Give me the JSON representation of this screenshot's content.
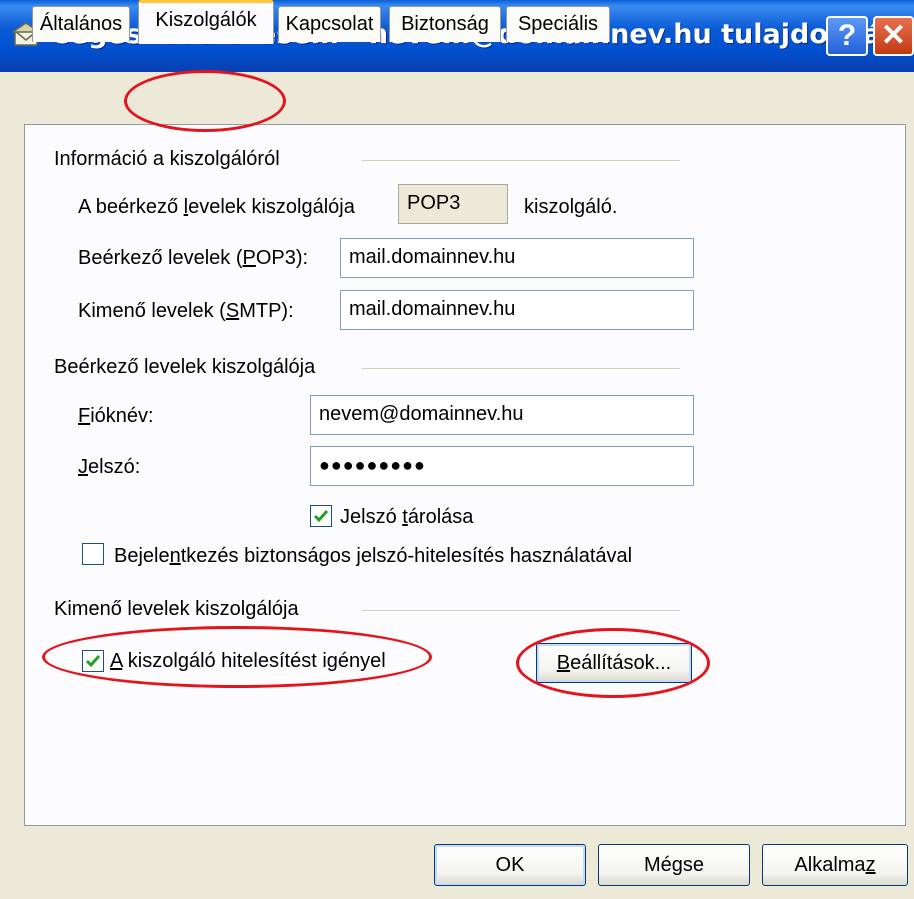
{
  "window": {
    "title": "Céges levelezésem - nevem@domainnev.hu tulajdonságai",
    "help_glyph": "?",
    "close_glyph": "✕"
  },
  "tabs": [
    {
      "label": "Általános"
    },
    {
      "label": "Kiszolgálók"
    },
    {
      "label": "Kapcsolat"
    },
    {
      "label": "Biztonság"
    },
    {
      "label": "Speciális"
    }
  ],
  "server_info": {
    "group_title": "Információ a kiszolgálóról",
    "incoming_type_label_pre": "A beérkező ",
    "incoming_type_label_ul": "l",
    "incoming_type_label_post": "evelek kiszolgálója",
    "incoming_type_value": "POP3",
    "incoming_type_suffix": "kiszolgáló.",
    "pop3_label_pre": "Beérkező levelek (",
    "pop3_label_ul": "P",
    "pop3_label_post": "OP3):",
    "pop3_value": "mail.domainnev.hu",
    "smtp_label_pre": "Kimenő levelek (",
    "smtp_label_ul": "S",
    "smtp_label_post": "MTP):",
    "smtp_value": "mail.domainnev.hu"
  },
  "incoming_server": {
    "group_title": "Beérkező levelek kiszolgálója",
    "account_label_ul": "F",
    "account_label_post": "ióknév:",
    "account_value": "nevem@domainnev.hu",
    "password_label_ul": "J",
    "password_label_post": "elszó:",
    "password_value": "●●●●●●●●●",
    "remember_label_pre": "Jelszó ",
    "remember_label_ul": "t",
    "remember_label_post": "árolása",
    "remember_checked": true,
    "spa_label_pre": "Bejele",
    "spa_label_ul": "n",
    "spa_label_post": "tkezés biztonságos jelszó-hitelesítés használatával",
    "spa_checked": false
  },
  "outgoing_server": {
    "group_title": "Kimenő levelek kiszolgálója",
    "auth_label_ul": "A",
    "auth_label_post": " kiszolgáló hitelesítést igényel",
    "auth_checked": true,
    "settings_button_ul": "B",
    "settings_button_post": "eállítások..."
  },
  "footer": {
    "ok": "OK",
    "cancel": "Mégse",
    "apply_pre": "Alkalma",
    "apply_ul": "z"
  },
  "colors": {
    "titlebar": "#0054e3",
    "annotation_red": "#e4141c",
    "dialog_bg": "#ece9d8"
  }
}
